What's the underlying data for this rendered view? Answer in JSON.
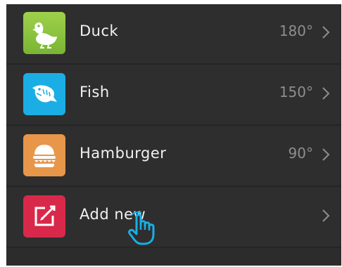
{
  "items": [
    {
      "label": "Duck",
      "value": "180°",
      "icon": "duck-icon",
      "color": "#8cc63f"
    },
    {
      "label": "Fish",
      "value": "150°",
      "icon": "fish-icon",
      "color": "#1aaee5"
    },
    {
      "label": "Hamburger",
      "value": "90°",
      "icon": "hamburger-icon",
      "color": "#e8964a"
    },
    {
      "label": "Add new",
      "value": "",
      "icon": "edit-icon",
      "color": "#d9294a"
    }
  ],
  "colors": {
    "panel_background": "#2c2c2c",
    "label_text": "#f2f2f2",
    "value_text": "#8e8e8e",
    "cursor": "#1aaee5"
  }
}
